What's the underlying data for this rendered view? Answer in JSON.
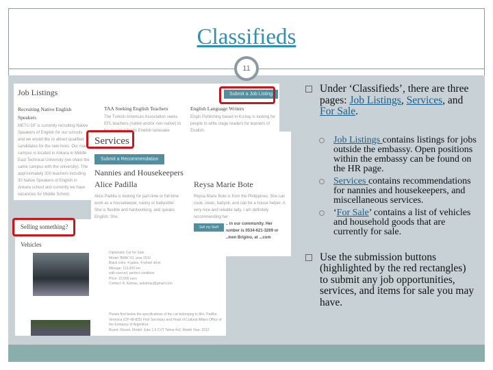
{
  "slide": {
    "title": "Classifieds",
    "number": "11"
  },
  "bullets": {
    "b1_pre": "Under ‘Classifieds’, there are three pages: ",
    "job_listings": "Job Listings",
    "sep1": ", ",
    "services": "Services",
    "sep2": ", and ",
    "for_sale": "For Sale",
    "end": ".",
    "sub": [
      {
        "link": "Job Listings ",
        "text": "contains listings for jobs outside the embassy. Open positions within the embassy can be found on the HR page."
      },
      {
        "link": "Services ",
        "text": "contains recommendations for nannies and housekeepers, and miscellaneous services."
      },
      {
        "pre": "‘",
        "link": "For Sale",
        "text": "’ contains a list of vehicles and household goods that are currently for sale."
      }
    ],
    "b2": "Use the submission buttons (highlighted by the red rectangles) to submit any job opportunities, services, and items for sale you may have."
  },
  "screens": {
    "jobs": {
      "heading": "Job Listings",
      "button": "Submit a Job Listing",
      "col1_title": "Recruiting Native English Speakers",
      "col1_text": "METU DF is currently recruiting Native Speakers of English for our schools and we would like to attract qualified candidates for the new hires. Our main campus is located in Ankara in Middle East Technical University (we share the same campus with the university). The approximately 300 teachers including 30 Native Speakers of English in Ankara school and currently we have vacancies for Middle School.",
      "col2_title": "TAA Seeking English Teachers",
      "col2_text": "The Turkish American Association seeks EFL teachers (native and/or non-native) to be recruited for its English language",
      "col3_title": "English Language Writers",
      "col3_text": "Engin Publishing based in Kızılay is looking for people to write stage readers for learners of English."
    },
    "services": {
      "heading": "Services",
      "button": "Submit a Recommendation",
      "section": "Nannies and Housekeepers",
      "p1_name": "Alice Padilla",
      "p1_text": "Alice Padilla is looking for part-time or full-time work as a housekeeper, nanny or babysitter. She is flexible and hardworking, and speaks English. She",
      "p2_name": "Reysa Marie Bote",
      "p2_text": "Reysa Marie Bote is from the Philippines. She can cook, clean, babysit, and can be a house helper. A very nice and reliable lady. I am definitely recommending her",
      "p2_more": "... in our community. Her number is 0534-621-3269 or ...men Brigino, at ...com",
      "btn2": "Sell my Stuff"
    },
    "sale": {
      "heading": "Selling something?",
      "section": "Vehicles",
      "car1": "Diplomatic Car for Sale\nModel: BMW X3, year 2010\nBlack color, 4 gates, 4 wheel drive\nMileage: 113,000 km\nwith sunroof, perfect condition\nPrice: 15,500 euro\nContact: A. Kamau, askamau@gmail.com",
      "car2": "Please find below the specifications of the car belonging to Mrs. Padilla Veronica (CP-48-825) First Secretary and Head of Cultural Affairs Office of the Embassy of Argentina:\nBrand: Nissan, Model: Juke 1.6 CVT Tekna 4x2, Model Year: 2012"
    }
  },
  "colors": {
    "title": "#2f8fb0",
    "band": "#c7d1d6",
    "footer": "#8aaeac",
    "highlight": "#c8161c",
    "button": "#4f8fa0"
  }
}
